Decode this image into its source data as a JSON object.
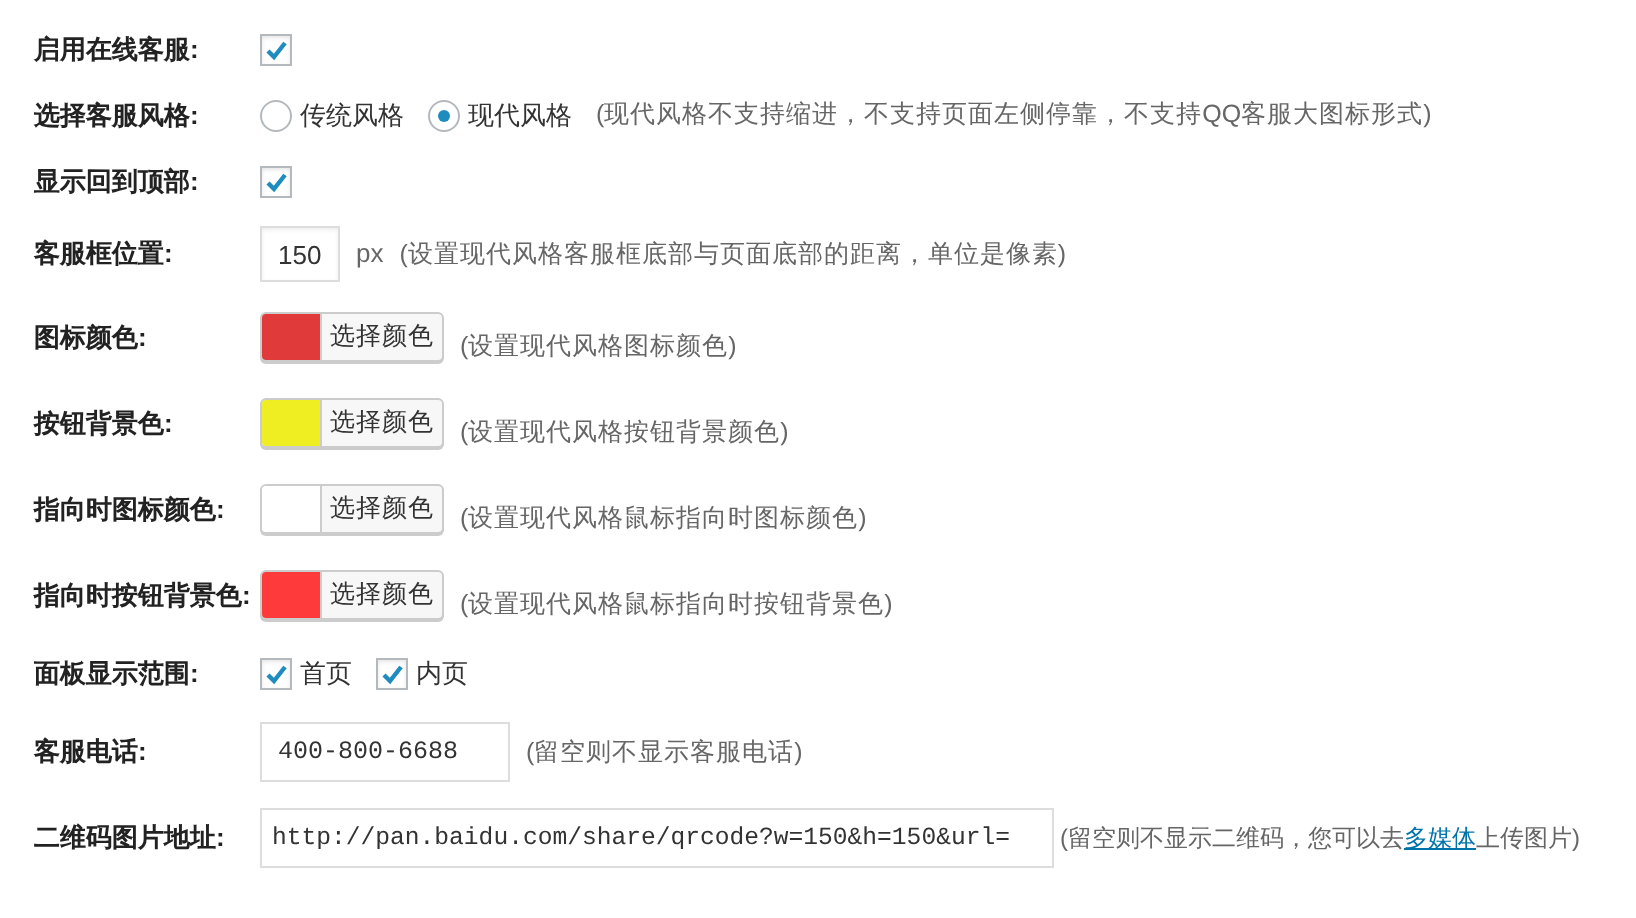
{
  "rows": [
    {
      "kind": "checkbox",
      "label": "启用在线客服:",
      "checked": true
    },
    {
      "kind": "radio",
      "label": "选择客服风格:",
      "options": [
        {
          "label": "传统风格",
          "selected": false
        },
        {
          "label": "现代风格",
          "selected": true
        }
      ],
      "hint": "(现代风格不支持缩进，不支持页面左侧停靠，不支持QQ客服大图标形式)"
    },
    {
      "kind": "checkbox",
      "label": "显示回到顶部:",
      "checked": true
    },
    {
      "kind": "number",
      "label": "客服框位置:",
      "value": "150",
      "unit": "px",
      "hint": "(设置现代风格客服框底部与页面底部的距离，单位是像素)"
    },
    {
      "kind": "color",
      "label": "图标颜色:",
      "color": "#e03a3a",
      "button": "选择颜色",
      "hint": "(设置现代风格图标颜色)"
    },
    {
      "kind": "color",
      "label": "按钮背景色:",
      "color": "#eeee22",
      "button": "选择颜色",
      "hint": "(设置现代风格按钮背景颜色)"
    },
    {
      "kind": "color",
      "label": "指向时图标颜色:",
      "color": "#ffffff",
      "button": "选择颜色",
      "hint": "(设置现代风格鼠标指向时图标颜色)"
    },
    {
      "kind": "color",
      "label": "指向时按钮背景色:",
      "color": "#ff3a3a",
      "button": "选择颜色",
      "hint": "(设置现代风格鼠标指向时按钮背景色)"
    },
    {
      "kind": "checks",
      "label": "面板显示范围:",
      "options": [
        {
          "label": "首页",
          "checked": true
        },
        {
          "label": "内页",
          "checked": true
        }
      ]
    },
    {
      "kind": "text",
      "label": "客服电话:",
      "value": "400-800-6688",
      "hint": "(留空则不显示客服电话)"
    },
    {
      "kind": "url",
      "label": "二维码图片地址:",
      "value": "http://pan.baidu.com/share/qrcode?w=150&h=150&url=",
      "hint_before": "(留空则不显示二维码，您可以去",
      "link": "多媒体",
      "hint_after": "上传图片)"
    }
  ]
}
